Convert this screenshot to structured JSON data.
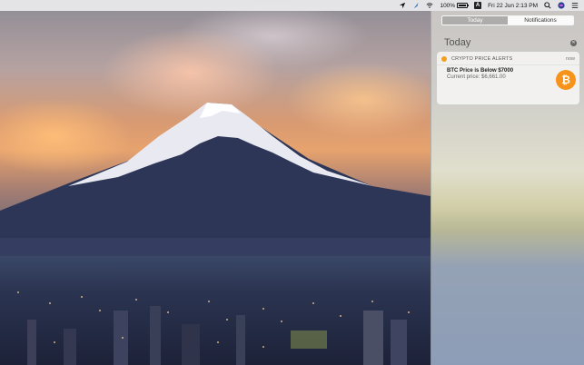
{
  "menubar": {
    "battery_percent": "100%",
    "battery_level": 1.0,
    "input_source": "A",
    "datetime": "Fri 22 Jun  2:13 PM",
    "icons": [
      "location-arrow-icon",
      "feather-icon",
      "wifi-icon",
      "battery-icon",
      "input-source-icon",
      "search-icon",
      "siri-icon",
      "notification-center-icon"
    ]
  },
  "notification_center": {
    "tabs": [
      {
        "label": "Today",
        "active": true
      },
      {
        "label": "Notifications",
        "active": false
      }
    ],
    "section_title": "Today",
    "notification": {
      "app_name": "CRYPTO PRICE ALERTS",
      "time": "now",
      "title": "BTC Price is Below $7000",
      "body": "Current price: $6,661.00",
      "icon": "bitcoin-icon",
      "icon_glyph": "₿",
      "accent_color": "#f7931a"
    }
  },
  "wallpaper": {
    "subject": "mountain-icon"
  }
}
